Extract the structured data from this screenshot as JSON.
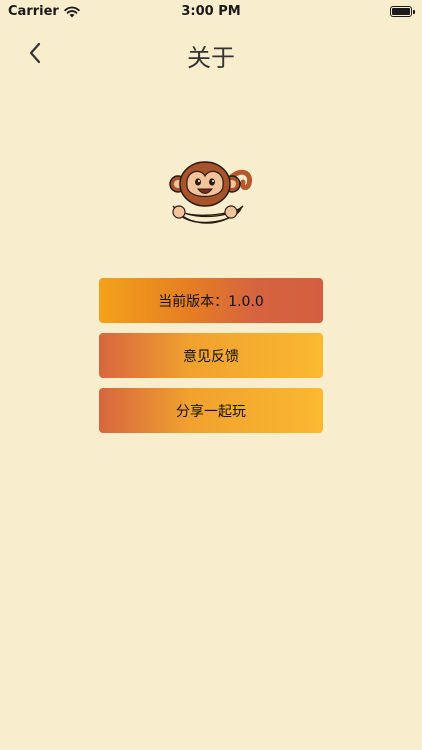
{
  "status_bar": {
    "carrier": "Carrier",
    "time": "3:00 PM"
  },
  "nav": {
    "title": "关于",
    "back_icon": "chevron-left-icon"
  },
  "logo": {
    "icon": "monkey-banana-logo"
  },
  "buttons": {
    "version": "当前版本：1.0.0",
    "feedback": "意见反馈",
    "share": "分享一起玩"
  },
  "colors": {
    "background": "#f8edcc",
    "button_orange": "#f3a21a",
    "button_red": "#d35f40",
    "button_yellow": "#fbb830"
  }
}
